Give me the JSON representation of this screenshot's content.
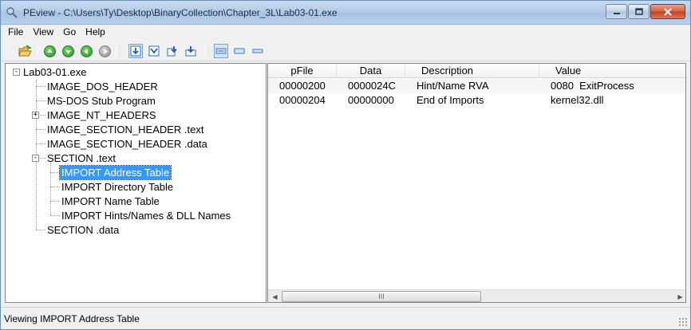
{
  "window": {
    "title": "PEview - C:\\Users\\Ty\\Desktop\\BinaryCollection\\Chapter_3L\\Lab03-01.exe"
  },
  "menu": [
    "File",
    "View",
    "Go",
    "Help"
  ],
  "toolbar": {
    "icons": [
      "open-folder-icon",
      "arrow-up-icon",
      "arrow-down-icon",
      "arrow-back-icon",
      "arrow-forward-icon",
      "byte-view-icon",
      "word-view-icon",
      "dword-view-icon",
      "qword-view-icon",
      "details-view-icon",
      "list-view-icon",
      "small-view-icon"
    ]
  },
  "tree": {
    "root": "Lab03-01.exe",
    "items": [
      "IMAGE_DOS_HEADER",
      "MS-DOS Stub Program",
      "IMAGE_NT_HEADERS",
      "IMAGE_SECTION_HEADER .text",
      "IMAGE_SECTION_HEADER .data",
      "SECTION .text",
      "IMPORT Address Table",
      "IMPORT Directory Table",
      "IMPORT Name Table",
      "IMPORT Hints/Names & DLL Names",
      "SECTION .data"
    ],
    "selected": "IMPORT Address Table",
    "expander_expanded": "-",
    "expander_collapsed": "+"
  },
  "list": {
    "columns": [
      "pFile",
      "Data",
      "Description",
      "Value"
    ],
    "rows": [
      [
        "00000200",
        "0000024C",
        "Hint/Name RVA",
        "0080  ExitProcess"
      ],
      [
        "00000204",
        "00000000",
        "End of Imports",
        "kernel32.dll"
      ]
    ],
    "scroll_thumb_label": "III"
  },
  "status": {
    "text": "Viewing IMPORT Address Table"
  },
  "colors": {
    "selection": "#3399ff",
    "titlebar": "#b4cde8",
    "close_button": "#c2401e"
  }
}
